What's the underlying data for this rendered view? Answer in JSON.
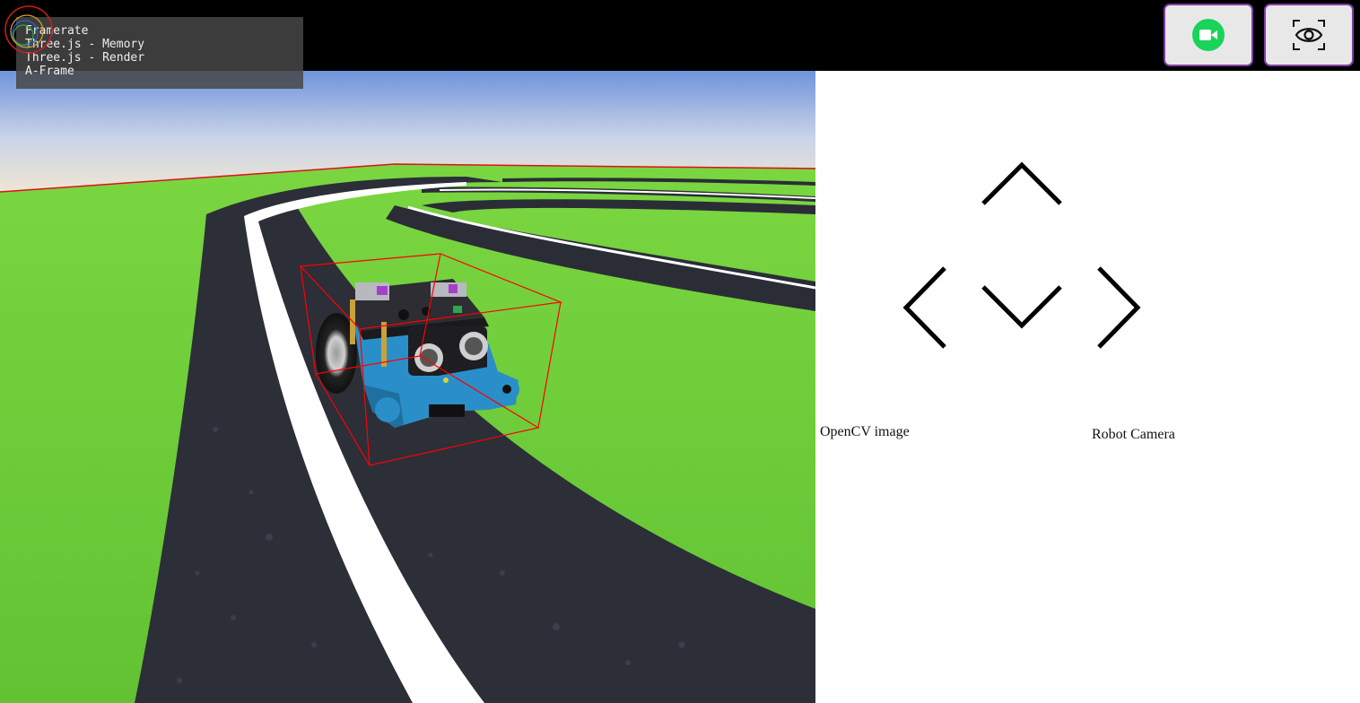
{
  "stats_panel": {
    "rows": [
      "Framerate",
      "Three.js - Memory",
      "Three.js - Render",
      "A-Frame"
    ]
  },
  "toolbar": {
    "record_icon": "video-camera-icon",
    "view_icon": "eye-icon",
    "record_color": "#19d35b"
  },
  "controls": {
    "up_icon": "chevron-up-icon",
    "down_icon": "chevron-down-icon",
    "left_icon": "chevron-left-icon",
    "right_icon": "chevron-right-icon"
  },
  "panels": {
    "opencv_label": "OpenCV image",
    "camera_label": "Robot Camera"
  },
  "scene": {
    "grass_color": "#6fd13a",
    "track_color": "#2b2d36",
    "line_color": "#ffffff",
    "sky_color": "#7fa2e0",
    "bounding_box_color": "#ff0000",
    "robot_color": "#2a8fc9"
  }
}
